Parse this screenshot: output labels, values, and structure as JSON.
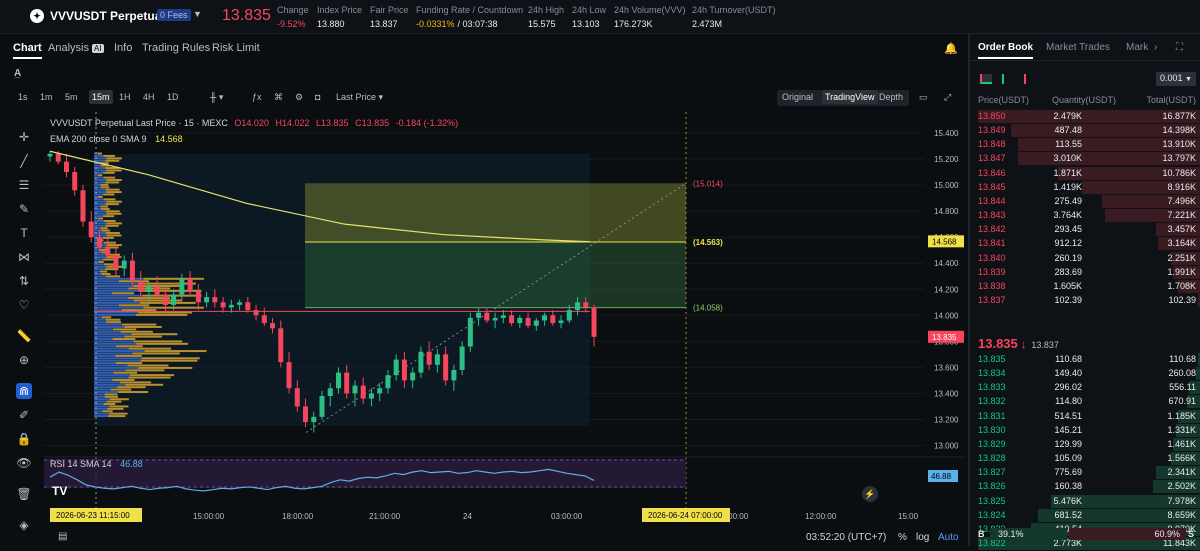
{
  "header": {
    "symbol": "VVVUSDT Perpetual",
    "fees_badge": "0 Fees",
    "price": "13.835",
    "stats": [
      {
        "label": "Change",
        "value": "-9.52%",
        "color": "#f6465d"
      },
      {
        "label": "Index Price",
        "value": "13.880",
        "color": "#eaecef"
      },
      {
        "label": "Fair Price",
        "value": "13.837",
        "color": "#eaecef"
      },
      {
        "label": "Funding Rate / Countdown",
        "value": "-0.0331%",
        "value2": "/ 03:07:38",
        "color": "#f0b90b"
      },
      {
        "label": "24h High",
        "value": "15.575",
        "color": "#eaecef"
      },
      {
        "label": "24h Low",
        "value": "13.103",
        "color": "#eaecef"
      },
      {
        "label": "24h Volume(VVV)",
        "value": "176.273K",
        "color": "#eaecef"
      },
      {
        "label": "24h Turnover(USDT)",
        "value": "2.473M",
        "color": "#eaecef"
      }
    ]
  },
  "chart_tabs": [
    {
      "label": "Chart",
      "active": true
    },
    {
      "label": "Analysis",
      "badge": "AI",
      "active": false
    },
    {
      "label": "Info",
      "active": false
    },
    {
      "label": "Trading Rules",
      "active": false
    },
    {
      "label": "Risk Limit",
      "active": false
    }
  ],
  "timeframes": [
    {
      "label": "1s",
      "active": false
    },
    {
      "label": "1m",
      "active": false
    },
    {
      "label": "5m",
      "active": false
    },
    {
      "label": "15m",
      "active": true
    },
    {
      "label": "1H",
      "active": false
    },
    {
      "label": "4H",
      "active": false
    },
    {
      "label": "1D",
      "active": false
    }
  ],
  "last_price_dropdown": "Last Price",
  "view_modes": [
    {
      "label": "Original",
      "active": false
    },
    {
      "label": "TradingView",
      "active": true
    },
    {
      "label": "Depth",
      "active": false
    }
  ],
  "legend": {
    "title": "VVVUSDT Perpetual Last Price · 15 · MEXC",
    "o": "O14.020",
    "h": "H14.022",
    "l": "L13.835",
    "c": "C13.835",
    "chg": "-0.184 (-1.32%)",
    "ema_label": "EMA 200 close 0 SMA 9",
    "ema_value": "14.568"
  },
  "price_axis": [
    "15.400",
    "15.200",
    "15.000",
    "14.800",
    "14.600",
    "14.400",
    "14.200",
    "14.000",
    "13.800",
    "13.600",
    "13.400",
    "13.200",
    "13.000"
  ],
  "price_tags": {
    "ema": "14.568",
    "last": "13.835",
    "rsi": "46.88"
  },
  "position_labels": {
    "target": "(15.014)",
    "entry": "(14.563)",
    "stop": "(14.058)"
  },
  "rsi_legend": {
    "label": "RSI 14 SMA 14",
    "value": "46.88"
  },
  "time_axis": [
    "15:00:00",
    "18:00:00",
    "21:00:00",
    "24",
    "03:00:00",
    "09:00:00",
    "12:00:00",
    "15:00"
  ],
  "time_highlights": {
    "start": "2026-06-23   11:15:00",
    "end": "2026-06-24   07:00:00"
  },
  "bottom_bar": {
    "clock": "03:52:20 (UTC+7)",
    "percent": "%",
    "log": "log",
    "auto": "Auto"
  },
  "orderbook": {
    "tabs": [
      {
        "label": "Order Book",
        "active": true
      },
      {
        "label": "Market Trades",
        "active": false
      },
      {
        "label": "Mark",
        "active": false
      }
    ],
    "precision": "0.001",
    "headers": [
      "Price(USDT)",
      "Quantity(USDT)",
      "Total(USDT)"
    ],
    "asks": [
      [
        "13.850",
        "2.479K",
        "16.877K",
        1.0
      ],
      [
        "13.849",
        "487.48",
        "14.398K",
        0.85
      ],
      [
        "13.848",
        "113.55",
        "13.910K",
        0.82
      ],
      [
        "13.847",
        "3.010K",
        "13.797K",
        0.82
      ],
      [
        "13.846",
        "1.871K",
        "10.786K",
        0.64
      ],
      [
        "13.845",
        "1.419K",
        "8.916K",
        0.53
      ],
      [
        "13.844",
        "275.49",
        "7.496K",
        0.44
      ],
      [
        "13.843",
        "3.764K",
        "7.221K",
        0.43
      ],
      [
        "13.842",
        "293.45",
        "3.457K",
        0.2
      ],
      [
        "13.841",
        "912.12",
        "3.164K",
        0.19
      ],
      [
        "13.840",
        "260.19",
        "2.251K",
        0.13
      ],
      [
        "13.839",
        "283.69",
        "1.991K",
        0.12
      ],
      [
        "13.838",
        "1.605K",
        "1.708K",
        0.1
      ],
      [
        "13.837",
        "102.39",
        "102.39",
        0.01
      ]
    ],
    "mid_price": "13.835",
    "mid_arrow": "↓",
    "mid_mark": "13.837",
    "bids": [
      [
        "13.835",
        "110.68",
        "110.68",
        0.01
      ],
      [
        "13.834",
        "149.40",
        "260.08",
        0.02
      ],
      [
        "13.833",
        "296.02",
        "556.11",
        0.05
      ],
      [
        "13.832",
        "114.80",
        "670.91",
        0.06
      ],
      [
        "13.831",
        "514.51",
        "1.185K",
        0.1
      ],
      [
        "13.830",
        "145.21",
        "1.331K",
        0.11
      ],
      [
        "13.829",
        "129.99",
        "1.461K",
        0.12
      ],
      [
        "13.828",
        "105.09",
        "1.566K",
        0.13
      ],
      [
        "13.827",
        "775.69",
        "2.341K",
        0.2
      ],
      [
        "13.826",
        "160.38",
        "2.502K",
        0.21
      ],
      [
        "13.825",
        "5.476K",
        "7.978K",
        0.67
      ],
      [
        "13.824",
        "681.52",
        "8.659K",
        0.73
      ],
      [
        "13.823",
        "410.54",
        "9.070K",
        0.76
      ],
      [
        "13.822",
        "2.773K",
        "11.843K",
        1.0
      ]
    ],
    "ratio_b": "B",
    "ratio_b_val": "39.1%",
    "ratio_s_val": "60.9%",
    "ratio_s": "S",
    "buy_fraction": 0.391
  },
  "chart_data": {
    "type": "candlestick",
    "ylim": [
      12.95,
      15.5
    ],
    "ema200": [
      [
        0,
        15.26
      ],
      [
        20,
        15.08
      ],
      [
        40,
        14.86
      ],
      [
        60,
        14.7
      ],
      [
        80,
        14.62
      ],
      [
        100,
        14.58
      ],
      [
        110,
        14.565
      ]
    ],
    "candles": [
      [
        15.22,
        15.26,
        15.18,
        15.24
      ],
      [
        15.24,
        15.26,
        15.16,
        15.18
      ],
      [
        15.18,
        15.24,
        15.06,
        15.1
      ],
      [
        15.1,
        15.14,
        14.92,
        14.96
      ],
      [
        14.96,
        15.0,
        14.68,
        14.72
      ],
      [
        14.72,
        14.8,
        14.56,
        14.6
      ],
      [
        14.6,
        14.66,
        14.48,
        14.52
      ],
      [
        14.52,
        14.6,
        14.42,
        14.46
      ],
      [
        14.46,
        14.54,
        14.3,
        14.36
      ],
      [
        14.36,
        14.46,
        14.3,
        14.42
      ],
      [
        14.42,
        14.48,
        14.22,
        14.26
      ],
      [
        14.26,
        14.34,
        14.12,
        14.18
      ],
      [
        14.18,
        14.26,
        14.1,
        14.22
      ],
      [
        14.22,
        14.3,
        14.12,
        14.16
      ],
      [
        14.16,
        14.22,
        14.02,
        14.08
      ],
      [
        14.08,
        14.2,
        14.04,
        14.16
      ],
      [
        14.16,
        14.32,
        14.12,
        14.28
      ],
      [
        14.28,
        14.34,
        14.14,
        14.18
      ],
      [
        14.18,
        14.24,
        14.04,
        14.1
      ],
      [
        14.1,
        14.18,
        14.06,
        14.14
      ],
      [
        14.14,
        14.2,
        14.06,
        14.1
      ],
      [
        14.1,
        14.14,
        14.02,
        14.06
      ],
      [
        14.06,
        14.12,
        14.02,
        14.08
      ],
      [
        14.08,
        14.12,
        14.04,
        14.1
      ],
      [
        14.1,
        14.14,
        14.02,
        14.04
      ],
      [
        14.04,
        14.08,
        13.96,
        14.0
      ],
      [
        14.0,
        14.06,
        13.92,
        13.94
      ],
      [
        13.94,
        13.98,
        13.86,
        13.9
      ],
      [
        13.9,
        13.96,
        13.6,
        13.64
      ],
      [
        13.64,
        13.72,
        13.4,
        13.44
      ],
      [
        13.44,
        13.5,
        13.26,
        13.3
      ],
      [
        13.3,
        13.36,
        13.14,
        13.18
      ],
      [
        13.18,
        13.26,
        13.1,
        13.22
      ],
      [
        13.22,
        13.42,
        13.2,
        13.38
      ],
      [
        13.38,
        13.48,
        13.3,
        13.44
      ],
      [
        13.44,
        13.6,
        13.4,
        13.56
      ],
      [
        13.56,
        13.62,
        13.36,
        13.4
      ],
      [
        13.4,
        13.5,
        13.3,
        13.46
      ],
      [
        13.46,
        13.52,
        13.32,
        13.36
      ],
      [
        13.36,
        13.44,
        13.3,
        13.4
      ],
      [
        13.4,
        13.48,
        13.34,
        13.44
      ],
      [
        13.44,
        13.58,
        13.4,
        13.54
      ],
      [
        13.54,
        13.7,
        13.5,
        13.66
      ],
      [
        13.66,
        13.72,
        13.44,
        13.5
      ],
      [
        13.5,
        13.6,
        13.44,
        13.56
      ],
      [
        13.56,
        13.76,
        13.52,
        13.72
      ],
      [
        13.72,
        13.8,
        13.58,
        13.62
      ],
      [
        13.62,
        13.74,
        13.56,
        13.7
      ],
      [
        13.7,
        13.76,
        13.46,
        13.5
      ],
      [
        13.5,
        13.62,
        13.42,
        13.58
      ],
      [
        13.58,
        13.8,
        13.54,
        13.76
      ],
      [
        13.76,
        14.02,
        13.72,
        13.98
      ],
      [
        13.98,
        14.06,
        13.92,
        14.02
      ],
      [
        14.02,
        14.06,
        13.94,
        13.96
      ],
      [
        13.96,
        14.02,
        13.9,
        13.98
      ],
      [
        13.98,
        14.04,
        13.94,
        14.0
      ],
      [
        14.0,
        14.04,
        13.92,
        13.94
      ],
      [
        13.94,
        14.0,
        13.9,
        13.98
      ],
      [
        13.98,
        14.02,
        13.9,
        13.92
      ],
      [
        13.92,
        13.98,
        13.88,
        13.96
      ],
      [
        13.96,
        14.02,
        13.92,
        14.0
      ],
      [
        14.0,
        14.04,
        13.92,
        13.94
      ],
      [
        13.94,
        14.0,
        13.9,
        13.96
      ],
      [
        13.96,
        14.08,
        13.94,
        14.04
      ],
      [
        14.04,
        14.14,
        14.0,
        14.1
      ],
      [
        14.1,
        14.14,
        14.02,
        14.06
      ],
      [
        14.06,
        14.08,
        13.76,
        13.835
      ]
    ],
    "rsi": [
      52,
      60,
      55,
      48,
      40,
      37,
      35,
      34,
      36,
      38,
      35,
      33,
      35,
      36,
      38,
      34,
      32,
      31,
      33,
      35,
      34,
      36,
      37,
      35,
      33,
      36,
      38,
      35,
      34,
      36,
      38,
      44,
      48,
      46,
      50,
      52,
      51,
      54,
      58,
      56,
      60,
      62,
      59,
      60,
      61,
      58,
      59,
      62,
      60,
      58,
      60,
      61,
      59,
      60,
      62,
      64,
      61,
      58,
      56,
      54,
      47
    ]
  }
}
